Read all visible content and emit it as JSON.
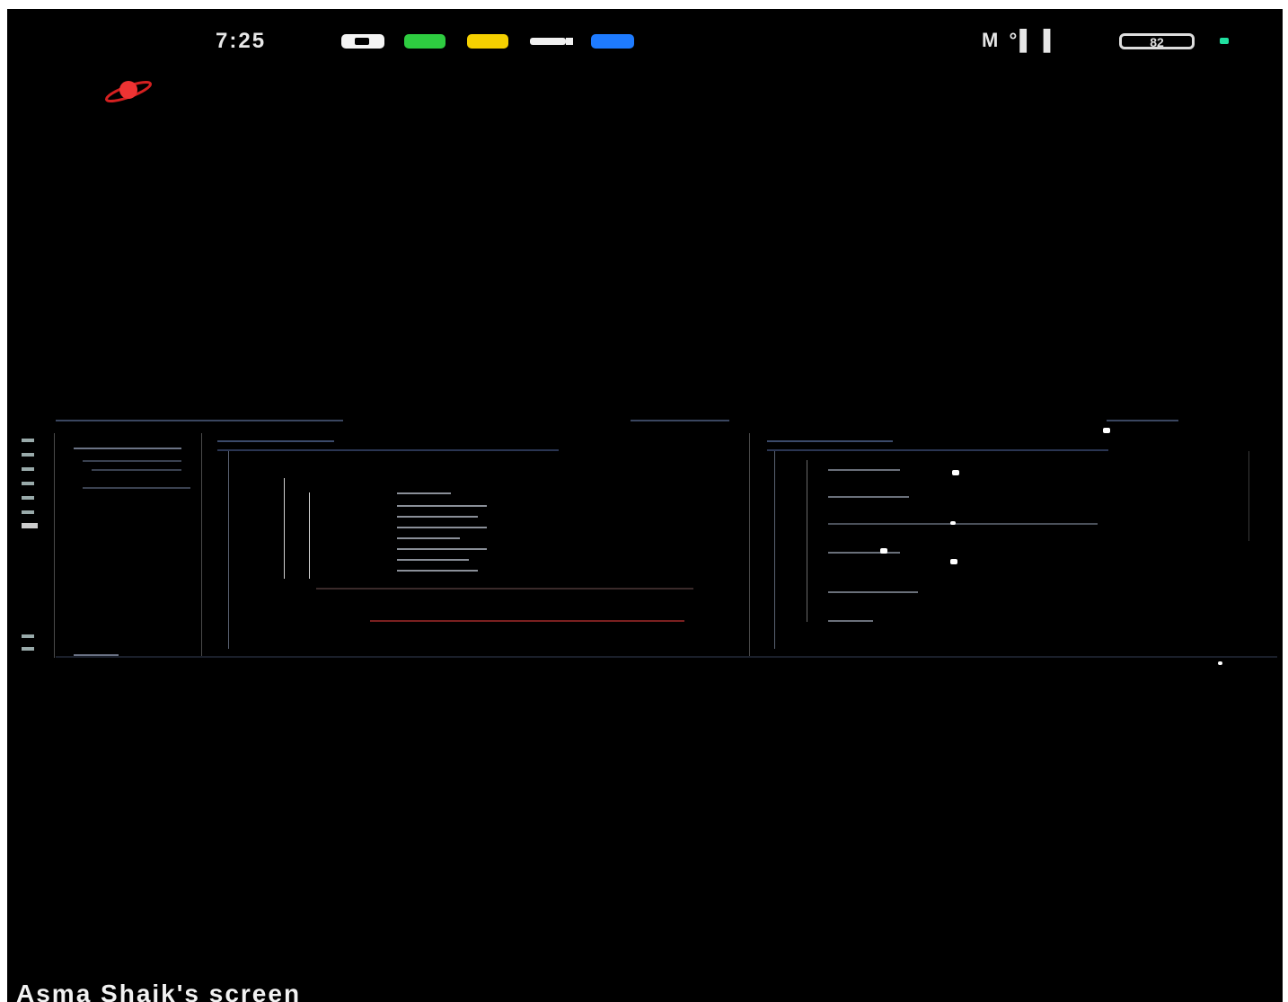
{
  "status_bar": {
    "time": "7:25",
    "signal_text": "M °▌▐",
    "battery": "82"
  },
  "icons": {
    "notification_1": "chat-bubble-icon",
    "notification_2": "whatsapp-icon",
    "notification_3": "snapchat-icon",
    "notification_4": "video-call-icon",
    "notification_5": "messages-icon",
    "app_logo": "planet-icon",
    "charging": "charging-dot-icon"
  },
  "colors": {
    "background": "#000000",
    "whatsapp": "#2ecc40",
    "snapchat": "#f5d000",
    "blue_app": "#1e7bff"
  },
  "shared_screen": {
    "caption": "Asma Shaik's screen"
  }
}
